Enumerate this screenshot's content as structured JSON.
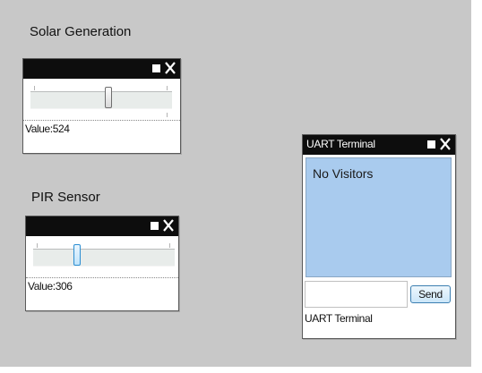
{
  "colors": {
    "background": "#c8c8c8",
    "titlebar": "#0d0d0d",
    "terminal_output": "#a9cbee",
    "slider_thumb_active": "#2c8ed2"
  },
  "widgets": [
    {
      "section_label": "Solar Generation",
      "titlebar_icons": [
        "square-icon",
        "close-icon"
      ],
      "slider_level": 0.55,
      "value_text": "Value:524"
    },
    {
      "section_label": "PIR Sensor",
      "titlebar_icons": [
        "square-icon",
        "close-icon"
      ],
      "slider_level": 0.3,
      "value_text": "Value:306"
    }
  ],
  "uart": {
    "title": "UART Terminal",
    "titlebar_icons": [
      "square-icon",
      "close-icon"
    ],
    "output_text": "No Visitors",
    "input_value": "",
    "input_placeholder": "",
    "send_label": "Send",
    "footer_label": "UART Terminal"
  }
}
